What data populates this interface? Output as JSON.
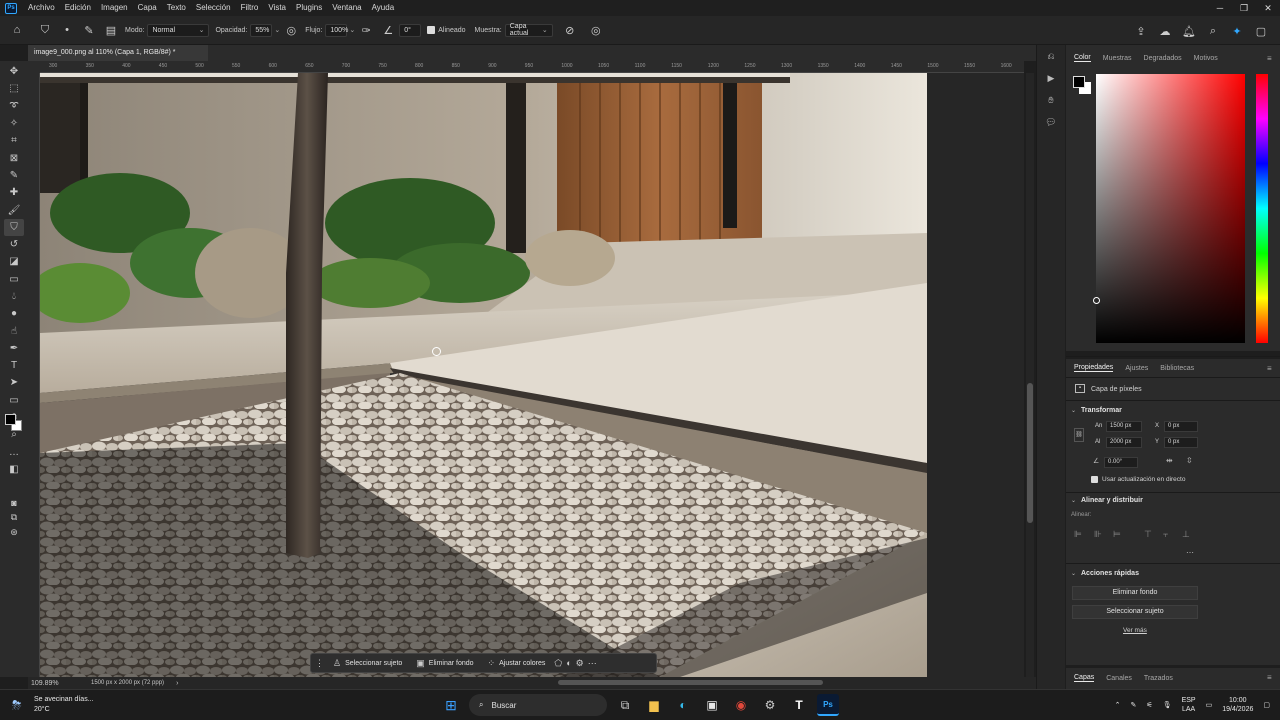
{
  "menu": {
    "app_logo": "Ps",
    "items": [
      "Archivo",
      "Edición",
      "Imagen",
      "Capa",
      "Texto",
      "Selección",
      "Filtro",
      "Vista",
      "Plugins",
      "Ventana",
      "Ayuda"
    ]
  },
  "options": {
    "mode_label": "Modo:",
    "mode_value": "Normal",
    "opacity_label": "Opacidad:",
    "opacity_value": "55%",
    "flow_label": "Flujo:",
    "flow_value": "100%",
    "angle_value": "0°",
    "aligned_label": "Alineado",
    "sample_label": "Muestra:",
    "sample_value": "Capa actual"
  },
  "document": {
    "tab_title": "image9_000.png al 110% (Capa 1, RGB/8#) *",
    "zoom": "109.89%",
    "size_info": "1500 px x 2000 px (72 ppp)"
  },
  "ruler": {
    "ticks": [
      "300",
      "350",
      "400",
      "450",
      "500",
      "550",
      "600",
      "650",
      "700",
      "750",
      "800",
      "850",
      "900",
      "950",
      "1000",
      "1050",
      "1100",
      "1150",
      "1200",
      "1250",
      "1300",
      "1350",
      "1400",
      "1450",
      "1500",
      "1550",
      "1600"
    ]
  },
  "context_bar": {
    "select_subject": "Seleccionar sujeto",
    "remove_bg": "Eliminar fondo",
    "adjust_colors": "Ajustar colores"
  },
  "color_panel": {
    "tabs": [
      "Color",
      "Muestras",
      "Degradados",
      "Motivos"
    ]
  },
  "properties": {
    "tabs": [
      "Propiedades",
      "Ajustes",
      "Bibliotecas"
    ],
    "layer_type": "Capa de píxeles",
    "transform_title": "Transformar",
    "w_label": "An",
    "w_value": "1500 px",
    "x_label": "X",
    "x_value": "0 px",
    "h_label": "Al",
    "h_value": "2000 px",
    "y_label": "Y",
    "y_value": "0 px",
    "angle_value": "0.00°",
    "live_update": "Usar actualización en directo",
    "align_title": "Alinear y distribuir",
    "align_label": "Alinear:",
    "quick_title": "Acciones rápidas",
    "remove_bg_btn": "Eliminar fondo",
    "select_subject_btn": "Seleccionar sujeto",
    "more_link": "Ver más"
  },
  "layers_panel": {
    "tabs": [
      "Capas",
      "Canales",
      "Trazados"
    ]
  },
  "taskbar": {
    "weather_line1": "Se avecinan días...",
    "weather_line2": "20°C",
    "search_placeholder": "Buscar",
    "lang_line1": "ESP",
    "lang_line2": "LAA",
    "time": "10:00",
    "date": "19/4/2026"
  },
  "colors": {
    "accent": "#31a8ff",
    "panel_bg": "#2b2b2b",
    "app_bg": "#1e1e1e"
  }
}
